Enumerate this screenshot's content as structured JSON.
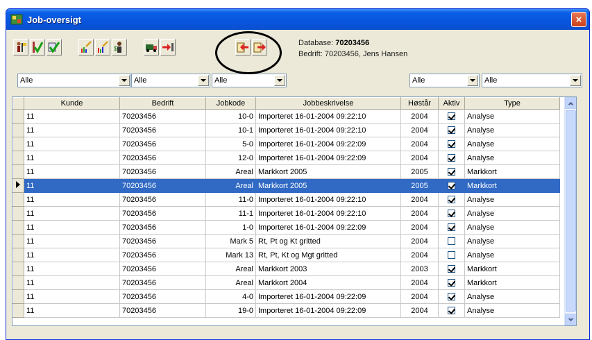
{
  "window": {
    "title": "Job-oversigt",
    "close_glyph": "×"
  },
  "toolbar": {
    "buttons": [
      {
        "name": "new-job-button",
        "icon": "person-flag-icon"
      },
      {
        "name": "approve-button",
        "icon": "green-check-icon"
      },
      {
        "name": "approve-all-button",
        "icon": "blue-check-icon"
      },
      {
        "name": "chart-edit-button",
        "icon": "chart-pencil-icon"
      },
      {
        "name": "chart-edit2-button",
        "icon": "chart-pencil2-icon"
      },
      {
        "name": "person-dollar-button",
        "icon": "person-dollar-icon"
      },
      {
        "name": "truck-button",
        "icon": "truck-icon"
      },
      {
        "name": "move-button",
        "icon": "arrow-in-icon"
      },
      {
        "name": "import-button",
        "icon": "import-arrow-icon"
      },
      {
        "name": "export-button",
        "icon": "export-arrow-icon"
      }
    ]
  },
  "info": {
    "database_label": "Database:",
    "database_value": "70203456",
    "company_label": "Bedrift:",
    "company_value": "70203456, Jens Hansen"
  },
  "filters": [
    "Alle",
    "Alle",
    "Alle",
    "Alle",
    "Alle"
  ],
  "table": {
    "headers": [
      "Kunde",
      "Bedrift",
      "Jobkode",
      "Jobbeskrivelse",
      "Høstår",
      "Aktiv",
      "Type"
    ],
    "rows": [
      {
        "kunde": "11",
        "bedrift": "70203456",
        "jobkode": "10-0",
        "beskrivelse": "Importeret 16-01-2004 09:22:10",
        "hostar": "2004",
        "aktiv": true,
        "type": "Analyse"
      },
      {
        "kunde": "11",
        "bedrift": "70203456",
        "jobkode": "10-1",
        "beskrivelse": "Importeret 16-01-2004 09:22:10",
        "hostar": "2004",
        "aktiv": true,
        "type": "Analyse"
      },
      {
        "kunde": "11",
        "bedrift": "70203456",
        "jobkode": "5-0",
        "beskrivelse": "Importeret 16-01-2004 09:22:09",
        "hostar": "2004",
        "aktiv": true,
        "type": "Analyse"
      },
      {
        "kunde": "11",
        "bedrift": "70203456",
        "jobkode": "12-0",
        "beskrivelse": "Importeret 16-01-2004 09:22:09",
        "hostar": "2004",
        "aktiv": true,
        "type": "Analyse"
      },
      {
        "kunde": "11",
        "bedrift": "70203456",
        "jobkode": "Areal",
        "beskrivelse": "Markkort 2005",
        "hostar": "2005",
        "aktiv": true,
        "type": "Markkort"
      },
      {
        "kunde": "11",
        "bedrift": "70203456",
        "jobkode": "Areal",
        "beskrivelse": "Markkort 2005",
        "hostar": "2005",
        "aktiv": true,
        "type": "Markkort",
        "selected": true
      },
      {
        "kunde": "11",
        "bedrift": "70203456",
        "jobkode": "11-0",
        "beskrivelse": "Importeret 16-01-2004 09:22:10",
        "hostar": "2004",
        "aktiv": true,
        "type": "Analyse"
      },
      {
        "kunde": "11",
        "bedrift": "70203456",
        "jobkode": "11-1",
        "beskrivelse": "Importeret 16-01-2004 09:22:10",
        "hostar": "2004",
        "aktiv": true,
        "type": "Analyse"
      },
      {
        "kunde": "11",
        "bedrift": "70203456",
        "jobkode": "1-0",
        "beskrivelse": "Importeret 16-01-2004 09:22:09",
        "hostar": "2004",
        "aktiv": true,
        "type": "Analyse"
      },
      {
        "kunde": "11",
        "bedrift": "70203456",
        "jobkode": "Mark 5",
        "beskrivelse": "Rt, Pt og Kt gritted",
        "hostar": "2004",
        "aktiv": false,
        "type": "Analyse"
      },
      {
        "kunde": "11",
        "bedrift": "70203456",
        "jobkode": "Mark 13",
        "beskrivelse": "Rt, Pt, Kt og Mgt gritted",
        "hostar": "2004",
        "aktiv": false,
        "type": "Analyse"
      },
      {
        "kunde": "11",
        "bedrift": "70203456",
        "jobkode": "Areal",
        "beskrivelse": "Markkort 2003",
        "hostar": "2003",
        "aktiv": true,
        "type": "Markkort"
      },
      {
        "kunde": "11",
        "bedrift": "70203456",
        "jobkode": "Areal",
        "beskrivelse": "Markkort 2004",
        "hostar": "2004",
        "aktiv": true,
        "type": "Markkort"
      },
      {
        "kunde": "11",
        "bedrift": "70203456",
        "jobkode": "4-0",
        "beskrivelse": "Importeret 16-01-2004 09:22:09",
        "hostar": "2004",
        "aktiv": true,
        "type": "Analyse"
      },
      {
        "kunde": "11",
        "bedrift": "70203456",
        "jobkode": "19-0",
        "beskrivelse": "Importeret 16-01-2004 09:22:09",
        "hostar": "2004",
        "aktiv": true,
        "type": "Analyse"
      }
    ]
  },
  "colors": {
    "title_bar": "#0855dd",
    "selection": "#316ac5",
    "window_bg": "#ece9d8",
    "annotation": "#000000"
  }
}
